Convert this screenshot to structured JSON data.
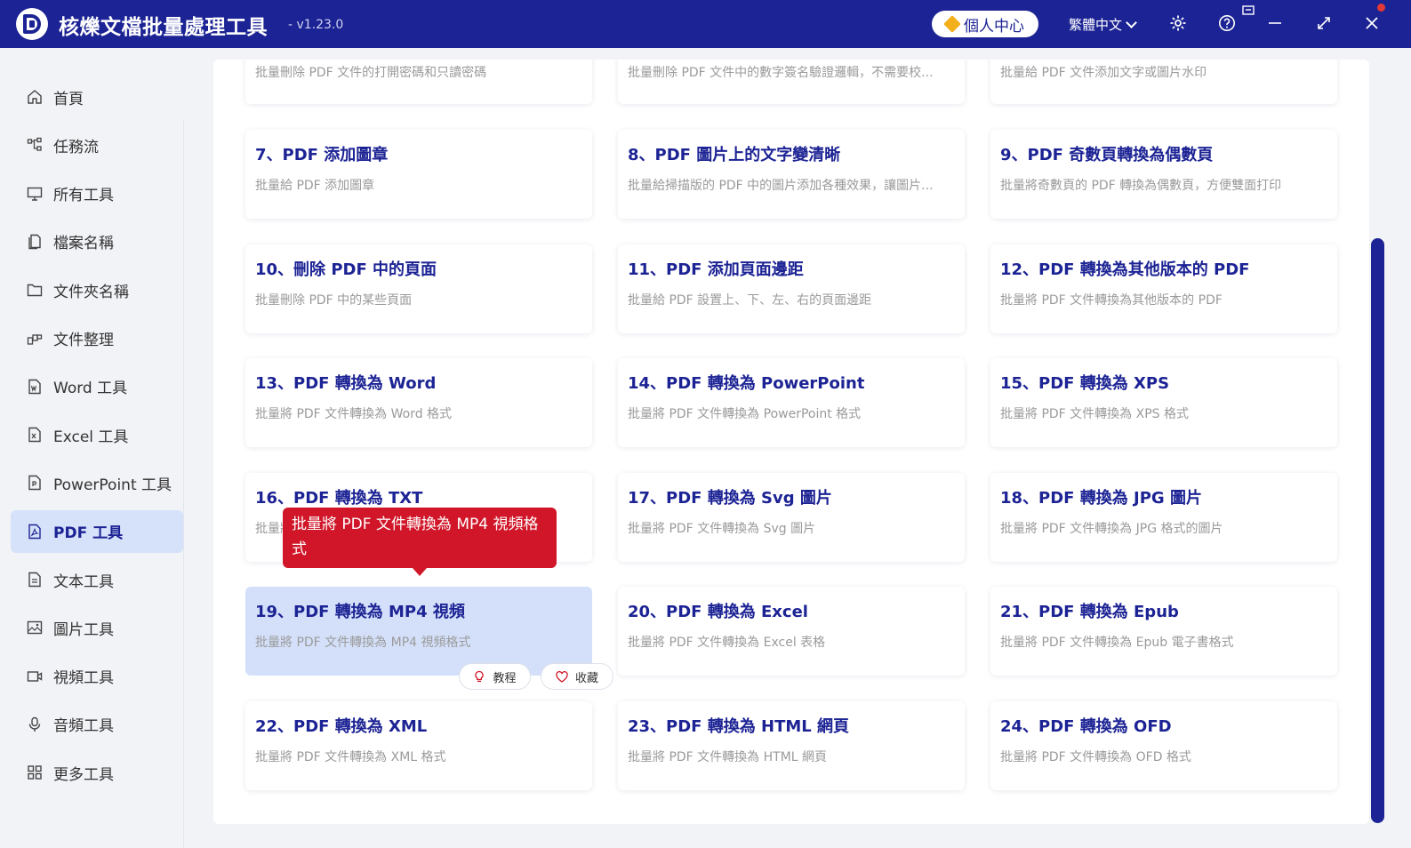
{
  "app": {
    "title": "核爍文檔批量處理工具",
    "version": "- v1.23.0"
  },
  "titlebar": {
    "user_center": "個人中心",
    "language": "繁體中文",
    "icons": [
      "settings-icon",
      "help-icon",
      "minimize-icon",
      "maximize-icon",
      "close-icon"
    ],
    "accent": "#1c2394"
  },
  "sidebar": {
    "items": [
      {
        "label": "首頁",
        "icon": "home-icon",
        "active": false
      },
      {
        "label": "任務流",
        "icon": "workflow-icon",
        "active": false
      },
      {
        "label": "所有工具",
        "icon": "monitor-icon",
        "active": false
      },
      {
        "label": "檔案名稱",
        "icon": "file-copy-icon",
        "active": false
      },
      {
        "label": "文件夾名稱",
        "icon": "folder-icon",
        "active": false
      },
      {
        "label": "文件整理",
        "icon": "organize-icon",
        "active": false
      },
      {
        "label": "Word 工具",
        "icon": "word-file-icon",
        "active": false
      },
      {
        "label": "Excel 工具",
        "icon": "excel-file-icon",
        "active": false
      },
      {
        "label": "PowerPoint 工具",
        "icon": "ppt-file-icon",
        "active": false
      },
      {
        "label": "PDF 工具",
        "icon": "pdf-file-icon",
        "active": true
      },
      {
        "label": "文本工具",
        "icon": "text-file-icon",
        "active": false
      },
      {
        "label": "圖片工具",
        "icon": "image-icon",
        "active": false
      },
      {
        "label": "視頻工具",
        "icon": "video-icon",
        "active": false
      },
      {
        "label": "音頻工具",
        "icon": "microphone-icon",
        "active": false
      },
      {
        "label": "更多工具",
        "icon": "grid-icon",
        "active": false
      }
    ]
  },
  "partial_row": [
    {
      "desc": "批量刪除 PDF 文件的打開密碼和只讀密碼"
    },
    {
      "desc": "批量刪除 PDF 文件中的數字簽名驗證邏輯，不需要校..."
    },
    {
      "desc": "批量給 PDF 文件添加文字或圖片水印"
    }
  ],
  "tools": [
    {
      "title": "7、PDF 添加圖章",
      "desc": "批量給 PDF 添加圖章"
    },
    {
      "title": "8、PDF 圖片上的文字變清晰",
      "desc": "批量給掃描版的 PDF 中的圖片添加各種效果，讓圖片..."
    },
    {
      "title": "9、PDF 奇數頁轉換為偶數頁",
      "desc": "批量將奇數頁的 PDF 轉換為偶數頁，方便雙面打印"
    },
    {
      "title": "10、刪除 PDF 中的頁面",
      "desc": "批量刪除 PDF 中的某些頁面"
    },
    {
      "title": "11、PDF 添加頁面邊距",
      "desc": "批量給 PDF 設置上、下、左、右的頁面邊距"
    },
    {
      "title": "12、PDF 轉換為其他版本的 PDF",
      "desc": "批量將 PDF 文件轉換為其他版本的 PDF"
    },
    {
      "title": "13、PDF 轉換為 Word",
      "desc": "批量將 PDF 文件轉換為 Word 格式"
    },
    {
      "title": "14、PDF 轉換為 PowerPoint",
      "desc": "批量將 PDF 文件轉換為 PowerPoint 格式"
    },
    {
      "title": "15、PDF 轉換為 XPS",
      "desc": "批量將 PDF 文件轉換為 XPS 格式"
    },
    {
      "title": "16、PDF 轉換為 TXT",
      "desc": "批量將 PDF 文件轉換為 TXT 格式"
    },
    {
      "title": "17、PDF 轉換為 Svg 圖片",
      "desc": "批量將 PDF 文件轉換為 Svg 圖片"
    },
    {
      "title": "18、PDF 轉換為 JPG 圖片",
      "desc": "批量將 PDF 文件轉換為 JPG 格式的圖片"
    },
    {
      "title": "19、PDF 轉換為 MP4 視頻",
      "desc": "批量將 PDF 文件轉換為 MP4 視頻格式"
    },
    {
      "title": "20、PDF 轉換為 Excel",
      "desc": "批量將 PDF 文件轉換為 Excel 表格"
    },
    {
      "title": "21、PDF 轉換為 Epub",
      "desc": "批量將 PDF 文件轉換為 Epub 電子書格式"
    },
    {
      "title": "22、PDF 轉換為 XML",
      "desc": "批量將 PDF 文件轉換為 XML 格式"
    },
    {
      "title": "23、PDF 轉換為 HTML 網頁",
      "desc": "批量將 PDF 文件轉換為 HTML 網頁"
    },
    {
      "title": "24、PDF 轉換為 OFD",
      "desc": "批量將 PDF 文件轉換為 OFD 格式"
    }
  ],
  "hover_actions": {
    "tutorial": "教程",
    "favorite": "收藏"
  },
  "tooltip": {
    "text": "批量將 PDF 文件轉換為 MP4 視頻格式"
  },
  "colors": {
    "accent": "#1c2394",
    "tooltip": "#d01628",
    "active_bg": "#d6e1fa"
  }
}
